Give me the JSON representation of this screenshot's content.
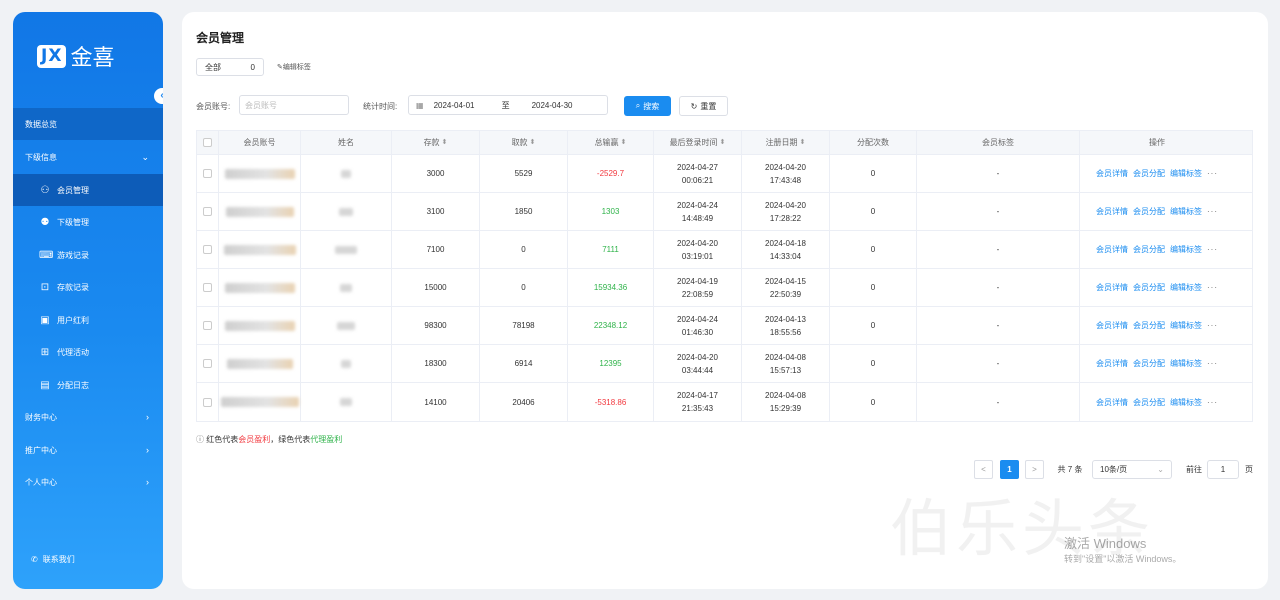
{
  "sidebar": {
    "logo_mark": "JX",
    "logo_text": "金喜",
    "items": [
      {
        "label": "数据总览"
      },
      {
        "label": "下级信息"
      },
      {
        "label": "会员管理"
      },
      {
        "label": "下级管理"
      },
      {
        "label": "游戏记录"
      },
      {
        "label": "存款记录"
      },
      {
        "label": "用户红利"
      },
      {
        "label": "代理活动"
      },
      {
        "label": "分配日志"
      },
      {
        "label": "财务中心"
      },
      {
        "label": "推广中心"
      },
      {
        "label": "个人中心"
      }
    ],
    "contact": "联系我们"
  },
  "main": {
    "title": "会员管理",
    "tag_filter": {
      "label": "全部",
      "count": "0"
    },
    "edit_tag": "编辑标签"
  },
  "search": {
    "account_label": "会员账号:",
    "account_placeholder": "会员账号",
    "time_label": "统计时间:",
    "start_date": "2024-04-01",
    "separator": "至",
    "end_date": "2024-04-30",
    "search_button": "搜索",
    "reset_button": "重置"
  },
  "table": {
    "headers": [
      "会员账号",
      "姓名",
      "存款",
      "取款",
      "总输赢",
      "最后登录时间",
      "注册日期",
      "分配次数",
      "会员标签",
      "操作"
    ],
    "rows": [
      {
        "deposit": "3000",
        "withdraw": "5529",
        "winloss": "-2529.7",
        "status": "red",
        "last_login_date": "2024-04-27",
        "last_login_time": "00:06:21",
        "reg_date": "2024-04-20",
        "reg_time": "17:43:48",
        "alloc": "0",
        "tag": "-"
      },
      {
        "deposit": "3100",
        "withdraw": "1850",
        "winloss": "1303",
        "status": "green",
        "last_login_date": "2024-04-24",
        "last_login_time": "14:48:49",
        "reg_date": "2024-04-20",
        "reg_time": "17:28:22",
        "alloc": "0",
        "tag": "-"
      },
      {
        "deposit": "7100",
        "withdraw": "0",
        "winloss": "7111",
        "status": "green",
        "last_login_date": "2024-04-20",
        "last_login_time": "03:19:01",
        "reg_date": "2024-04-18",
        "reg_time": "14:33:04",
        "alloc": "0",
        "tag": "-"
      },
      {
        "deposit": "15000",
        "withdraw": "0",
        "winloss": "15934.36",
        "status": "green",
        "last_login_date": "2024-04-19",
        "last_login_time": "22:08:59",
        "reg_date": "2024-04-15",
        "reg_time": "22:50:39",
        "alloc": "0",
        "tag": "-"
      },
      {
        "deposit": "98300",
        "withdraw": "78198",
        "winloss": "22348.12",
        "status": "green",
        "last_login_date": "2024-04-24",
        "last_login_time": "01:46:30",
        "reg_date": "2024-04-13",
        "reg_time": "18:55:56",
        "alloc": "0",
        "tag": "-"
      },
      {
        "deposit": "18300",
        "withdraw": "6914",
        "winloss": "12395",
        "status": "green",
        "last_login_date": "2024-04-20",
        "last_login_time": "03:44:44",
        "reg_date": "2024-04-08",
        "reg_time": "15:57:13",
        "alloc": "0",
        "tag": "-"
      },
      {
        "deposit": "14100",
        "withdraw": "20406",
        "winloss": "-5318.86",
        "status": "red",
        "last_login_date": "2024-04-17",
        "last_login_time": "21:35:43",
        "reg_date": "2024-04-08",
        "reg_time": "15:29:39",
        "alloc": "0",
        "tag": "-"
      }
    ],
    "actions": [
      "会员详情",
      "会员分配",
      "编辑标签"
    ],
    "more": "···"
  },
  "legend": {
    "p1": "红色代表",
    "red_text": "会员盈利",
    "p2": "，绿色代表",
    "green_text": "代理盈利"
  },
  "pagination": {
    "prev": "<",
    "page": "1",
    "next": ">",
    "total": "共 7 条",
    "per_page": "10条/页",
    "goto_label": "前往",
    "goto_value": "1",
    "unit": "页"
  },
  "watermark": {
    "text": "伯乐头条",
    "activate_title": "激活 Windows",
    "activate_sub": "转到\"设置\"以激活 Windows。"
  },
  "colors": {
    "primary": "#1a8cf0",
    "red": "#f2393f",
    "green": "#2fb34a",
    "sidebar_top": "#1177e6",
    "sidebar_bottom": "#2ea2fb"
  }
}
